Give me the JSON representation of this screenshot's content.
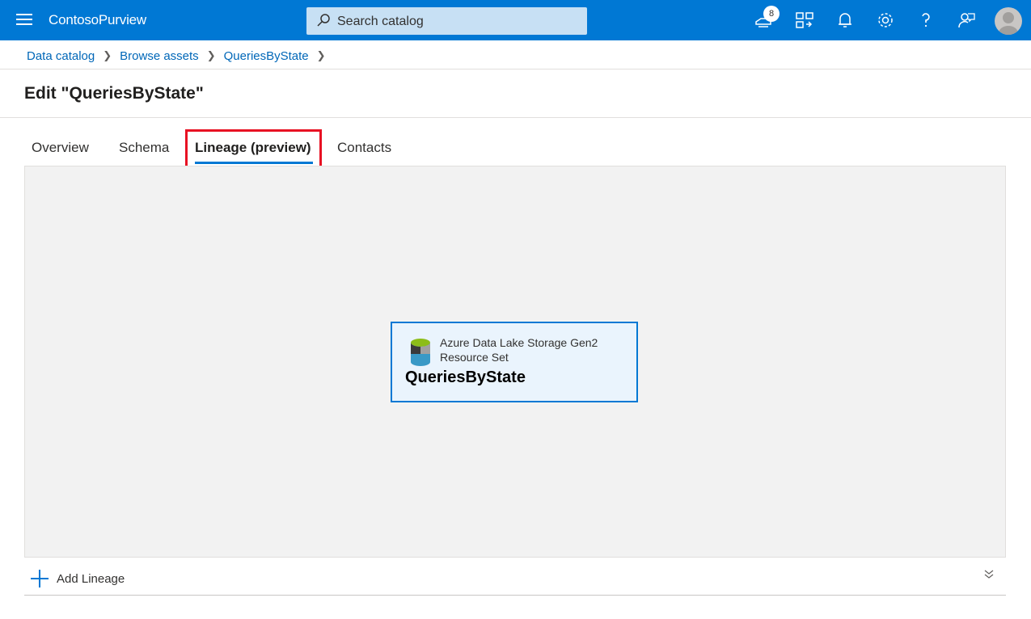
{
  "app": {
    "title": "ContosoPurview"
  },
  "search": {
    "placeholder": "Search catalog"
  },
  "topbar": {
    "notifications_count": "8"
  },
  "breadcrumb": {
    "items": [
      "Data catalog",
      "Browse assets",
      "QueriesByState"
    ]
  },
  "page": {
    "title": "Edit \"QueriesByState\""
  },
  "tabs": [
    {
      "label": "Overview"
    },
    {
      "label": "Schema"
    },
    {
      "label": "Lineage (preview)",
      "active": true
    },
    {
      "label": "Contacts"
    }
  ],
  "lineage": {
    "node": {
      "type_line1": "Azure Data Lake Storage Gen2",
      "type_line2": "Resource Set",
      "name": "QueriesByState",
      "icon": "adls-gen2-icon"
    }
  },
  "actions": {
    "add_lineage": "Add Lineage"
  },
  "colors": {
    "brand": "#0078d4",
    "highlight": "#e81123",
    "canvas": "#f2f2f2",
    "node_bg": "#eaf4fd"
  }
}
